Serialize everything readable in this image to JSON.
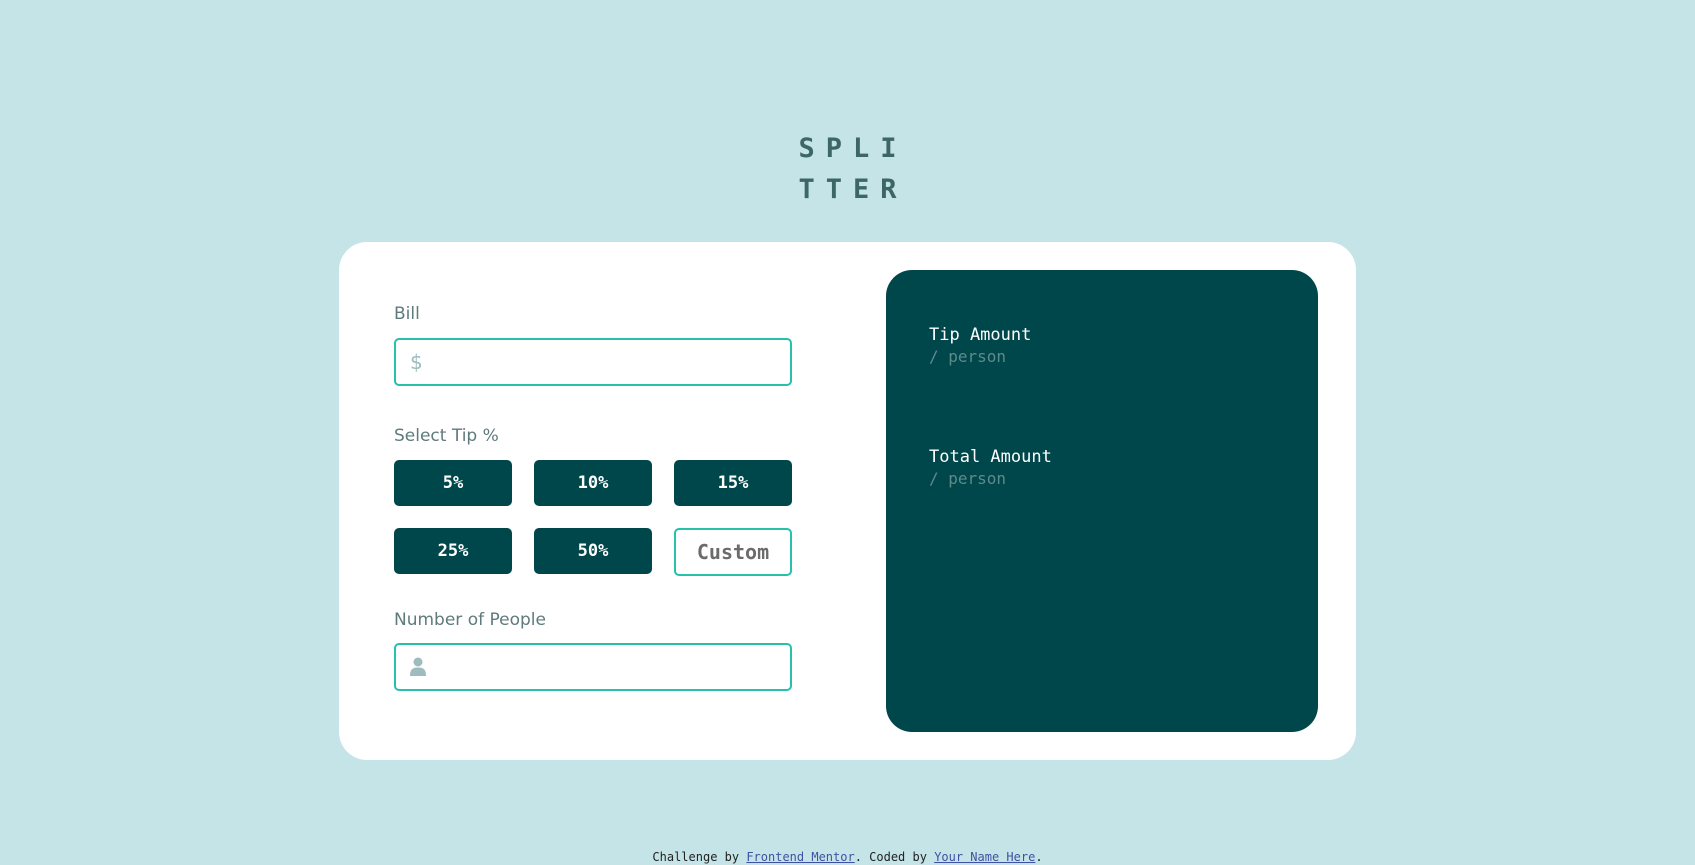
{
  "logo": {
    "line1": "SPLI",
    "line2": "TTER"
  },
  "bill": {
    "label": "Bill",
    "icon": "dollar-icon",
    "icon_glyph": "$",
    "value": "",
    "placeholder": ""
  },
  "tip": {
    "label": "Select Tip %",
    "options": [
      "5%",
      "10%",
      "15%",
      "25%",
      "50%"
    ],
    "custom_placeholder": "Custom"
  },
  "people": {
    "label": "Number of People",
    "icon": "person-icon",
    "value": "",
    "placeholder": ""
  },
  "results": {
    "tip_label": "Tip Amount",
    "tip_sub": "/ person",
    "total_label": "Total Amount",
    "total_sub": "/ person"
  },
  "footer": {
    "prefix": "Challenge by ",
    "link1": "Frontend Mentor",
    "middle": ". Coded by ",
    "link2": "Your Name Here",
    "suffix": "."
  },
  "colors": {
    "background": "#c5e4e7",
    "card": "#ffffff",
    "dark_teal": "#00474b",
    "accent_border": "#26c0ab",
    "label_gray": "#5e7a7d"
  }
}
